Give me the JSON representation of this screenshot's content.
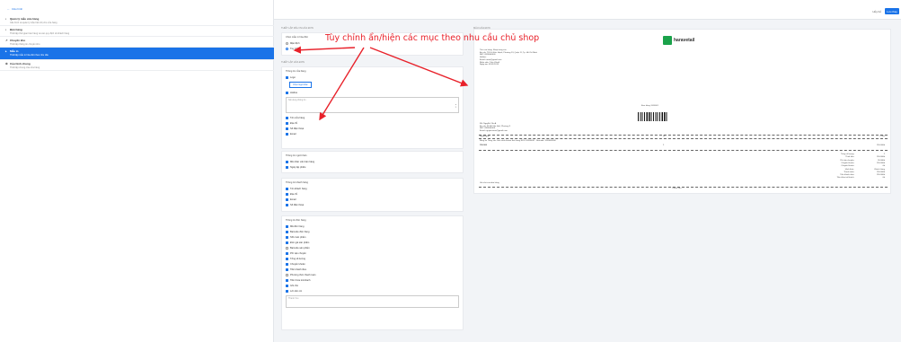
{
  "sidebar": {
    "back_label": "Cấu hình",
    "items": [
      {
        "title": "Quản lý mẫu cửa hàng",
        "desc": "Cấu hình và quản lý mẫu hiển thị cho cửa hàng",
        "icon": "store-icon"
      },
      {
        "title": "Bán hàng",
        "desc": "Thiết lập thời gian bán hàng và các quy định về khách hàng",
        "icon": "cart-icon"
      },
      {
        "title": "Chuyển kho",
        "desc": "Thiết lập thông tin chuyển kho",
        "icon": "truck-icon"
      },
      {
        "title": "Mẫu in",
        "desc": "Thiết lập mẫu in hóa đơn theo nhu cầu",
        "icon": "print-icon"
      },
      {
        "title": "Cấu hình chung",
        "desc": "Thiết lập chung của cửa hàng",
        "icon": "gear-icon"
      }
    ]
  },
  "topbar": {
    "cancel": "Hủy bỏ",
    "save": "Lưu thay"
  },
  "labels": {
    "template_section": "Thiết lập mẫu in hóa đơn",
    "settings_section": "Thiết lập hóa đơn",
    "preview_section": "Mẫu hóa đơn"
  },
  "template": {
    "title": "Chọn mẫu in hóa đơn",
    "options": [
      {
        "label": "Mặc định",
        "selected": false
      },
      {
        "label": "Tùy chỉnh",
        "selected": true
      }
    ]
  },
  "groups": {
    "store": {
      "title": "Thông tin cửa hàng",
      "logo_label": "Logo",
      "change_btn": "Chọn logo khác",
      "hotline_label": "Hotline",
      "textbox_ph": "Nội dung thông tin",
      "items": [
        {
          "label": "Tên cửa hàng",
          "checked": true
        },
        {
          "label": "Địa chỉ",
          "checked": true
        },
        {
          "label": "Số điện thoại",
          "checked": true
        },
        {
          "label": "Email",
          "checked": true
        }
      ]
    },
    "seller": {
      "title": "Thông tin người bán",
      "items": [
        {
          "label": "Mã nhân viên bán hàng",
          "checked": true
        },
        {
          "label": "Ngày lập phiếu",
          "checked": true
        }
      ]
    },
    "customer": {
      "title": "Thông tin khách hàng",
      "items": [
        {
          "label": "Tên khách hàng",
          "checked": true
        },
        {
          "label": "Địa chỉ",
          "checked": true
        },
        {
          "label": "Email",
          "checked": true
        },
        {
          "label": "Số điện thoại",
          "checked": true
        }
      ]
    },
    "order": {
      "title": "Thông tin đơn hàng",
      "items": [
        {
          "label": "Mã đơn hàng",
          "checked": true
        },
        {
          "label": "Barcode đơn hàng",
          "checked": true
        },
        {
          "label": "SKU sản phẩm",
          "checked": true
        },
        {
          "label": "Đơn giá sản phẩm",
          "checked": true
        },
        {
          "label": "Barcode sản phẩm",
          "checked": false
        },
        {
          "label": "Phí vận chuyển",
          "checked": true
        },
        {
          "label": "Tổng số lượng",
          "checked": true
        },
        {
          "label": "Chuyển khoản",
          "checked": true
        },
        {
          "label": "Tiền khách đưa",
          "checked": true
        },
        {
          "label": "Phương thức thanh toán",
          "checked": false
        },
        {
          "label": "Tiền thừa trả khách",
          "checked": true
        },
        {
          "label": "Ghi chú",
          "checked": true
        },
        {
          "label": "Lời cảm ơn",
          "checked": true
        }
      ],
      "thanks_text": "Thank You"
    }
  },
  "annotation": {
    "text": "Tùy chỉnh ẩn/hiện các mục theo nhu cầu chủ shop",
    "color": "#e8212a"
  },
  "preview": {
    "logo_text": "haravetail",
    "store_lines": [
      "Tên cửa hàng: Shop trang sức",
      "Địa chỉ: 720 Lê Đức Hạnh, Phường 13, Quận 11, Tp. Hồ Chí Minh",
      "SĐT: 0916000000",
      "Hotline:",
      "Email: name@gmail.com",
      "Nhân viên: Trần Văn A",
      "Ngày tạo: 01/01/2019"
    ],
    "order_code": "Đơn hàng #000001",
    "customer_lines": [
      "KH: Nguyễn Văn A",
      "Địa chỉ: 58 Hồ Văn Huê, Phường 9",
      "SĐT: 0906000001",
      "Email: nguyenvana@gmail.com"
    ],
    "table_header": [
      "Ngày/ngày",
      "SL",
      "T.Tiền"
    ],
    "product": {
      "note": "Bông tai Trang sức hình cánh bướm thời trang SKU: 00000001 - Barcode: 1000000000",
      "qty": "2",
      "price": "150.000",
      "total": "150.000đ"
    },
    "totals": [
      {
        "label": "Tổng số lượng:",
        "value": "2"
      },
      {
        "label": "Thuế tiền:",
        "value": "150.000đ"
      },
      {
        "label": "Phí vận chuyển:",
        "value": "30.000đ"
      },
      {
        "label": "Chuyển khoản:",
        "value": "150.000đ"
      },
      {
        "label": "Chuyển khoản:",
        "value": "0đ"
      },
      {
        "label": "Hình thức:",
        "value": "Khách hàng"
      },
      {
        "label": "Thanh toán:",
        "value": "150.000đ"
      },
      {
        "label": "Tiền khách đưa:",
        "value": "150.000đ"
      },
      {
        "label": "Tiền thừa trả khách:",
        "value": "0đ"
      }
    ],
    "note_label": "Ghi chú của đơn hàng",
    "thanks": "Thank You"
  }
}
